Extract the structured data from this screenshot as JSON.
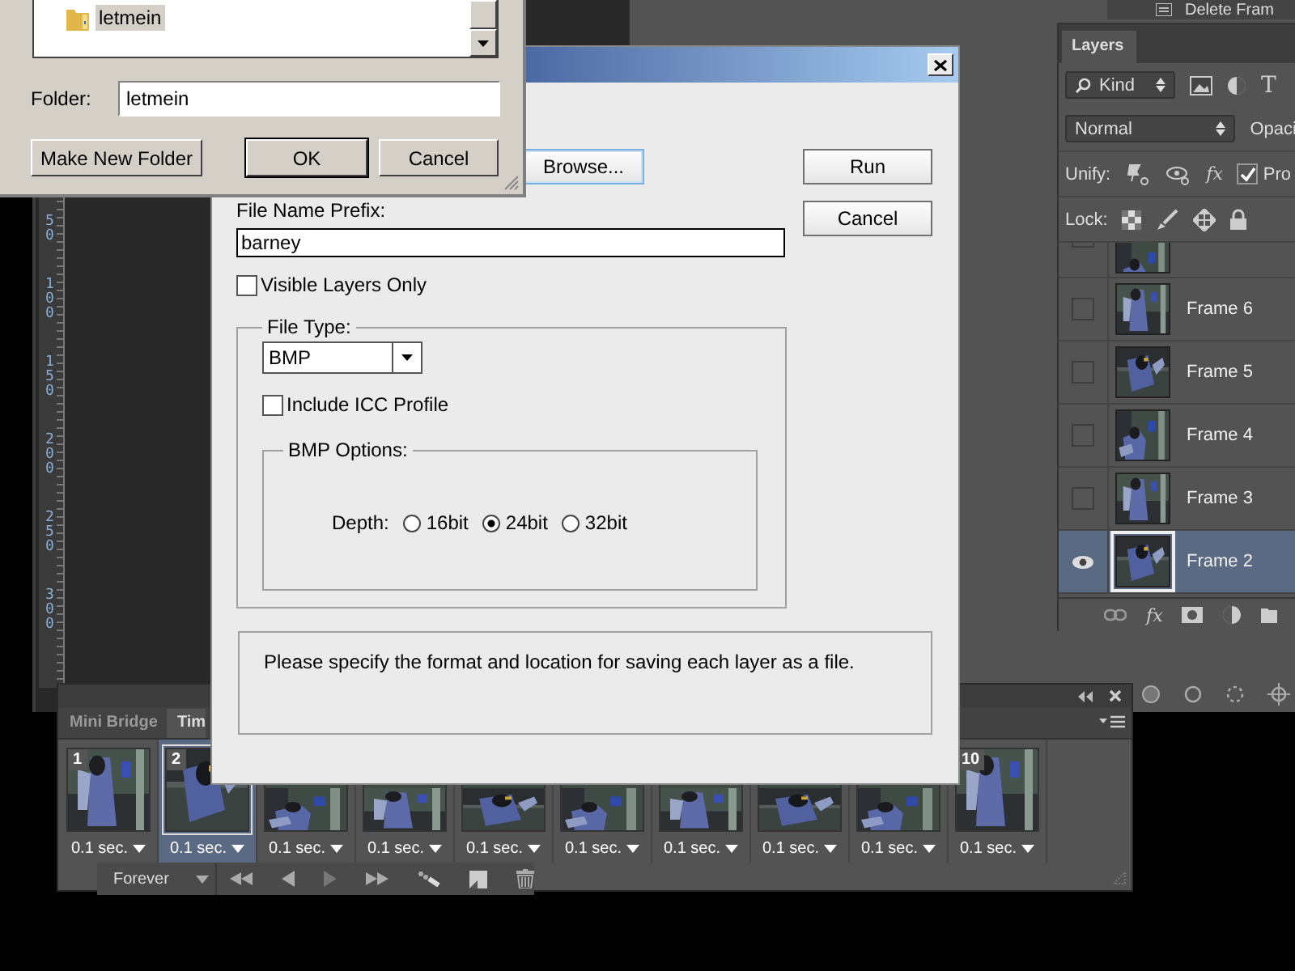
{
  "browse_dialog": {
    "tree_items": [
      {
        "label": "letmein",
        "selected": true
      }
    ],
    "folder_label": "Folder:",
    "folder_value": "letmein",
    "buttons": [
      {
        "label": "Make New Folder",
        "default": false
      },
      {
        "label": "OK",
        "default": true
      },
      {
        "label": "Cancel",
        "default": false
      }
    ]
  },
  "export_dialog": {
    "browse_button": "Browse...",
    "buttons": [
      "Run",
      "Cancel"
    ],
    "prefix_label": "File Name Prefix:",
    "prefix_value": "barney",
    "visible_only": {
      "label": "Visible Layers Only",
      "checked": false
    },
    "file_type": {
      "legend": "File Type:",
      "value": "BMP",
      "icc": {
        "label": "Include ICC Profile",
        "checked": false
      },
      "options_legend": "BMP Options:",
      "depth_label": "Depth:",
      "depths": [
        {
          "label": "16bit",
          "selected": false
        },
        {
          "label": "24bit",
          "selected": true
        },
        {
          "label": "32bit",
          "selected": false
        }
      ]
    },
    "message": "Please specify the format and location for saving each layer as a file."
  },
  "ruler": {
    "labels": [
      "50",
      "100",
      "150",
      "200",
      "250",
      "300"
    ]
  },
  "history_panel": {
    "item": "Delete Fram"
  },
  "layers_panel": {
    "tab": "Layers",
    "filter": "Kind",
    "type_filter": "T",
    "blend_mode": "Normal",
    "opacity_label": "Opaci",
    "unify_label": "Unify:",
    "fx_label": "fx",
    "propagate": {
      "label": "Pro",
      "checked": true
    },
    "lock_label": "Lock:",
    "layers": [
      {
        "cut_off": true,
        "visible": false,
        "selected": false
      },
      {
        "name": "Frame 6",
        "visible": false,
        "selected": false
      },
      {
        "name": "Frame 5",
        "visible": false,
        "selected": false
      },
      {
        "name": "Frame 4",
        "visible": false,
        "selected": false
      },
      {
        "name": "Frame 3",
        "visible": false,
        "selected": false
      },
      {
        "name": "Frame 2",
        "visible": true,
        "selected": true
      }
    ],
    "footer_fx": "fx"
  },
  "timeline": {
    "tabs": [
      {
        "label": "Mini Bridge",
        "selected": false
      },
      {
        "label": "Tim",
        "selected": true
      }
    ],
    "frames": [
      {
        "number": "1",
        "delay": "0.1 sec.",
        "selected": false
      },
      {
        "number": "2",
        "delay": "0.1 sec.",
        "selected": true
      },
      {
        "delay": "0.1 sec.",
        "selected": false
      },
      {
        "delay": "0.1 sec.",
        "selected": false
      },
      {
        "delay": "0.1 sec.",
        "selected": false
      },
      {
        "delay": "0.1 sec.",
        "selected": false
      },
      {
        "delay": "0.1 sec.",
        "selected": false
      },
      {
        "delay": "0.1 sec.",
        "selected": false
      },
      {
        "delay": "0.1 sec.",
        "selected": false
      },
      {
        "number": "10",
        "delay": "0.1 sec.",
        "selected": false
      }
    ],
    "loop": "Forever"
  }
}
